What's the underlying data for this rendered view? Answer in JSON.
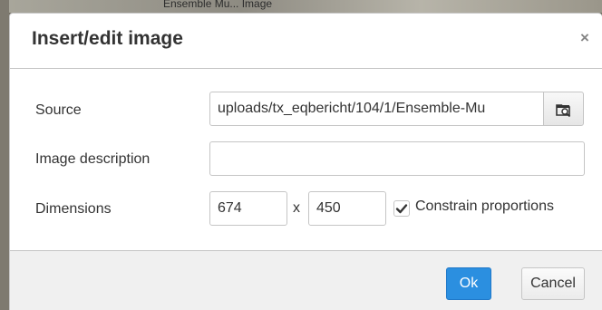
{
  "backdrop": {
    "caption": "Ensemble Mu... Image"
  },
  "dialog": {
    "title": "Insert/edit image",
    "close_glyph": "×"
  },
  "form": {
    "source": {
      "label": "Source",
      "value": "uploads/tx_eqbericht/104/1/Ensemble-Mu",
      "browse_icon": "folder-search-icon"
    },
    "description": {
      "label": "Image description",
      "value": ""
    },
    "dimensions": {
      "label": "Dimensions",
      "width": "674",
      "height": "450",
      "separator": "x",
      "constrain_label": "Constrain proportions",
      "constrain_checked": true
    }
  },
  "footer": {
    "ok_label": "Ok",
    "cancel_label": "Cancel"
  },
  "colors": {
    "primary_button": "#2b8fe0",
    "footer_bg": "#f0f0f0"
  }
}
